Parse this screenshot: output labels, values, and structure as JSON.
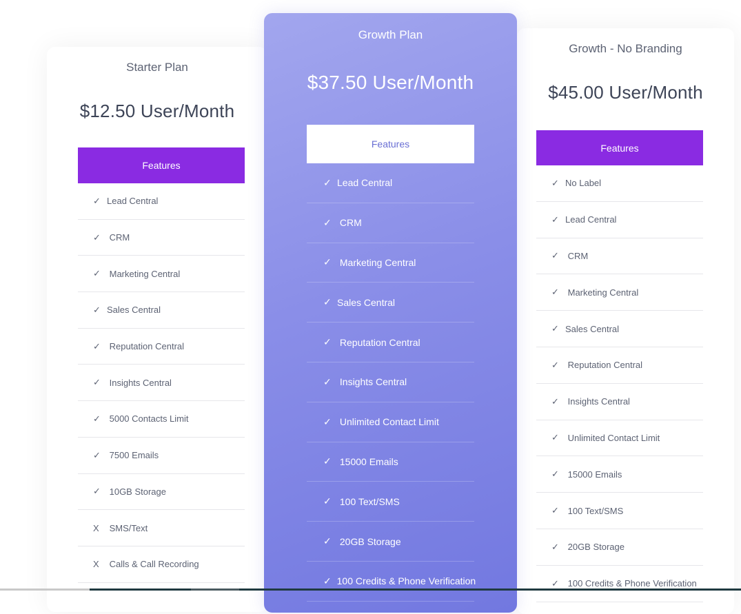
{
  "plans": [
    {
      "name": "Starter Plan",
      "price": "$12.50 User/Month",
      "features_label": "Features",
      "features": [
        {
          "mark": "✓",
          "text": "Lead Central",
          "included": true
        },
        {
          "mark": "✓",
          "text": " CRM",
          "included": true
        },
        {
          "mark": "✓",
          "text": " Marketing Central",
          "included": true
        },
        {
          "mark": "✓",
          "text": "Sales Central",
          "included": true
        },
        {
          "mark": "✓",
          "text": " Reputation Central",
          "included": true
        },
        {
          "mark": "✓",
          "text": " Insights Central",
          "included": true
        },
        {
          "mark": "✓",
          "text": " 5000 Contacts Limit",
          "included": true
        },
        {
          "mark": "✓",
          "text": " 7500 Emails",
          "included": true
        },
        {
          "mark": "✓",
          "text": " 10GB Storage",
          "included": true
        },
        {
          "mark": "X",
          "text": " SMS/Text",
          "included": false
        },
        {
          "mark": "X",
          "text": " Calls & Call Recording",
          "included": false
        }
      ]
    },
    {
      "name": "Growth Plan",
      "price": "$37.50 User/Month",
      "features_label": "Features",
      "features": [
        {
          "mark": "✓",
          "text": "Lead Central",
          "included": true
        },
        {
          "mark": "✓",
          "text": " CRM",
          "included": true
        },
        {
          "mark": "✓",
          "text": " Marketing Central",
          "included": true
        },
        {
          "mark": "✓",
          "text": "Sales Central",
          "included": true
        },
        {
          "mark": "✓",
          "text": " Reputation Central",
          "included": true
        },
        {
          "mark": "✓",
          "text": " Insights Central",
          "included": true
        },
        {
          "mark": "✓",
          "text": " Unlimited Contact Limit",
          "included": true
        },
        {
          "mark": "✓",
          "text": " 15000 Emails",
          "included": true
        },
        {
          "mark": "✓",
          "text": " 100 Text/SMS",
          "included": true
        },
        {
          "mark": "✓",
          "text": " 20GB Storage",
          "included": true
        },
        {
          "mark": "✓",
          "text": " 100 Credits & Phone Verification",
          "included": true
        }
      ]
    },
    {
      "name": "Growth - No Branding",
      "price": "$45.00 User/Month",
      "features_label": "Features",
      "features": [
        {
          "mark": "✓",
          "text": "No Label",
          "included": true
        },
        {
          "mark": "✓",
          "text": "Lead Central",
          "included": true
        },
        {
          "mark": "✓",
          "text": " CRM",
          "included": true
        },
        {
          "mark": "✓",
          "text": " Marketing Central",
          "included": true
        },
        {
          "mark": "✓",
          "text": "Sales Central",
          "included": true
        },
        {
          "mark": "✓",
          "text": " Reputation Central",
          "included": true
        },
        {
          "mark": "✓",
          "text": " Insights Central",
          "included": true
        },
        {
          "mark": "✓",
          "text": " Unlimited Contact Limit",
          "included": true
        },
        {
          "mark": "✓",
          "text": " 15000 Emails",
          "included": true
        },
        {
          "mark": "✓",
          "text": " 100 Text/SMS",
          "included": true
        },
        {
          "mark": "✓",
          "text": " 20GB Storage",
          "included": true
        },
        {
          "mark": "✓",
          "text": " 100 Credits & Phone Verification",
          "included": true
        }
      ]
    }
  ],
  "colors": {
    "features_button_bg": "#8a2be2",
    "featured_gradient_start": "#a2a6ee",
    "featured_gradient_end": "#7278e0",
    "text_muted": "#5c6273"
  }
}
